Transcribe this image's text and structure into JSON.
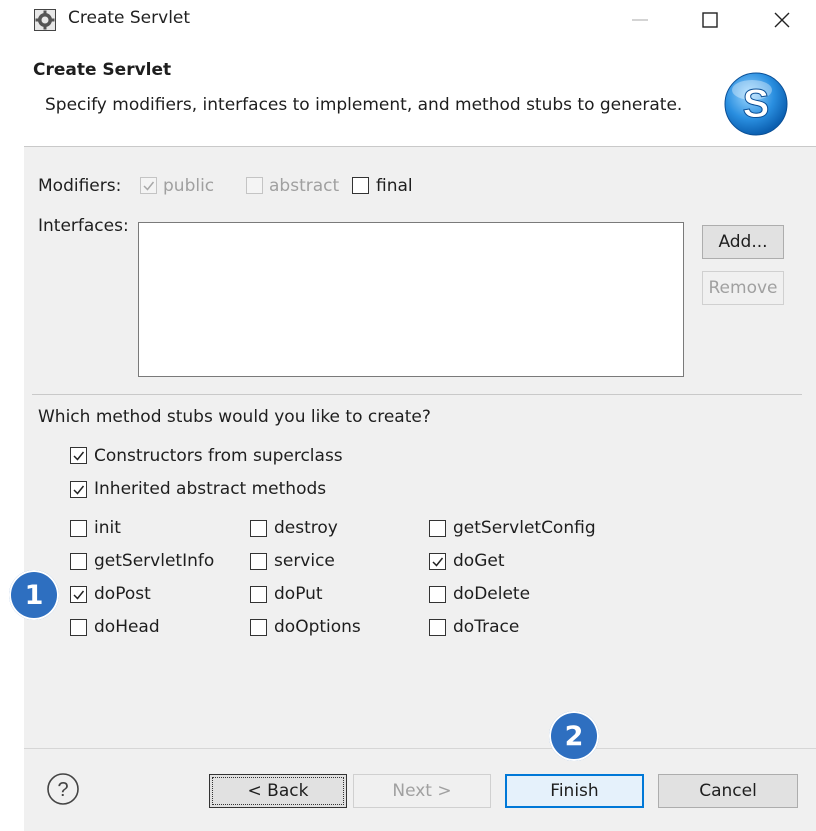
{
  "window": {
    "title": "Create Servlet",
    "icons": [
      "gear-icon",
      "minimize-icon",
      "maximize-icon",
      "close-icon"
    ]
  },
  "header": {
    "title": "Create Servlet",
    "description": "Specify modifiers, interfaces to implement, and method stubs to generate."
  },
  "modifiers": {
    "label": "Modifiers:",
    "public": {
      "label": "public",
      "checked": true,
      "enabled": false
    },
    "abstract": {
      "label": "abstract",
      "checked": false,
      "enabled": false
    },
    "final": {
      "label": "final",
      "checked": false,
      "enabled": true
    }
  },
  "interfaces": {
    "label": "Interfaces:",
    "add_label": "Add...",
    "remove_label": "Remove"
  },
  "stubs": {
    "question": "Which method stubs would you like to create?",
    "constructors": {
      "label": "Constructors from superclass",
      "checked": true
    },
    "inherited": {
      "label": "Inherited abstract methods",
      "checked": true
    },
    "methods": [
      {
        "label": "init",
        "checked": false
      },
      {
        "label": "destroy",
        "checked": false
      },
      {
        "label": "getServletConfig",
        "checked": false
      },
      {
        "label": "getServletInfo",
        "checked": false
      },
      {
        "label": "service",
        "checked": false
      },
      {
        "label": "doGet",
        "checked": true
      },
      {
        "label": "doPost",
        "checked": true
      },
      {
        "label": "doPut",
        "checked": false
      },
      {
        "label": "doDelete",
        "checked": false
      },
      {
        "label": "doHead",
        "checked": false
      },
      {
        "label": "doOptions",
        "checked": false
      },
      {
        "label": "doTrace",
        "checked": false
      }
    ]
  },
  "footer": {
    "help_label": "?",
    "back_label": "< Back",
    "next_label": "Next >",
    "finish_label": "Finish",
    "cancel_label": "Cancel"
  },
  "annotations": {
    "badge1": "1",
    "badge2": "2",
    "badge_color": "#2e6fc0"
  }
}
